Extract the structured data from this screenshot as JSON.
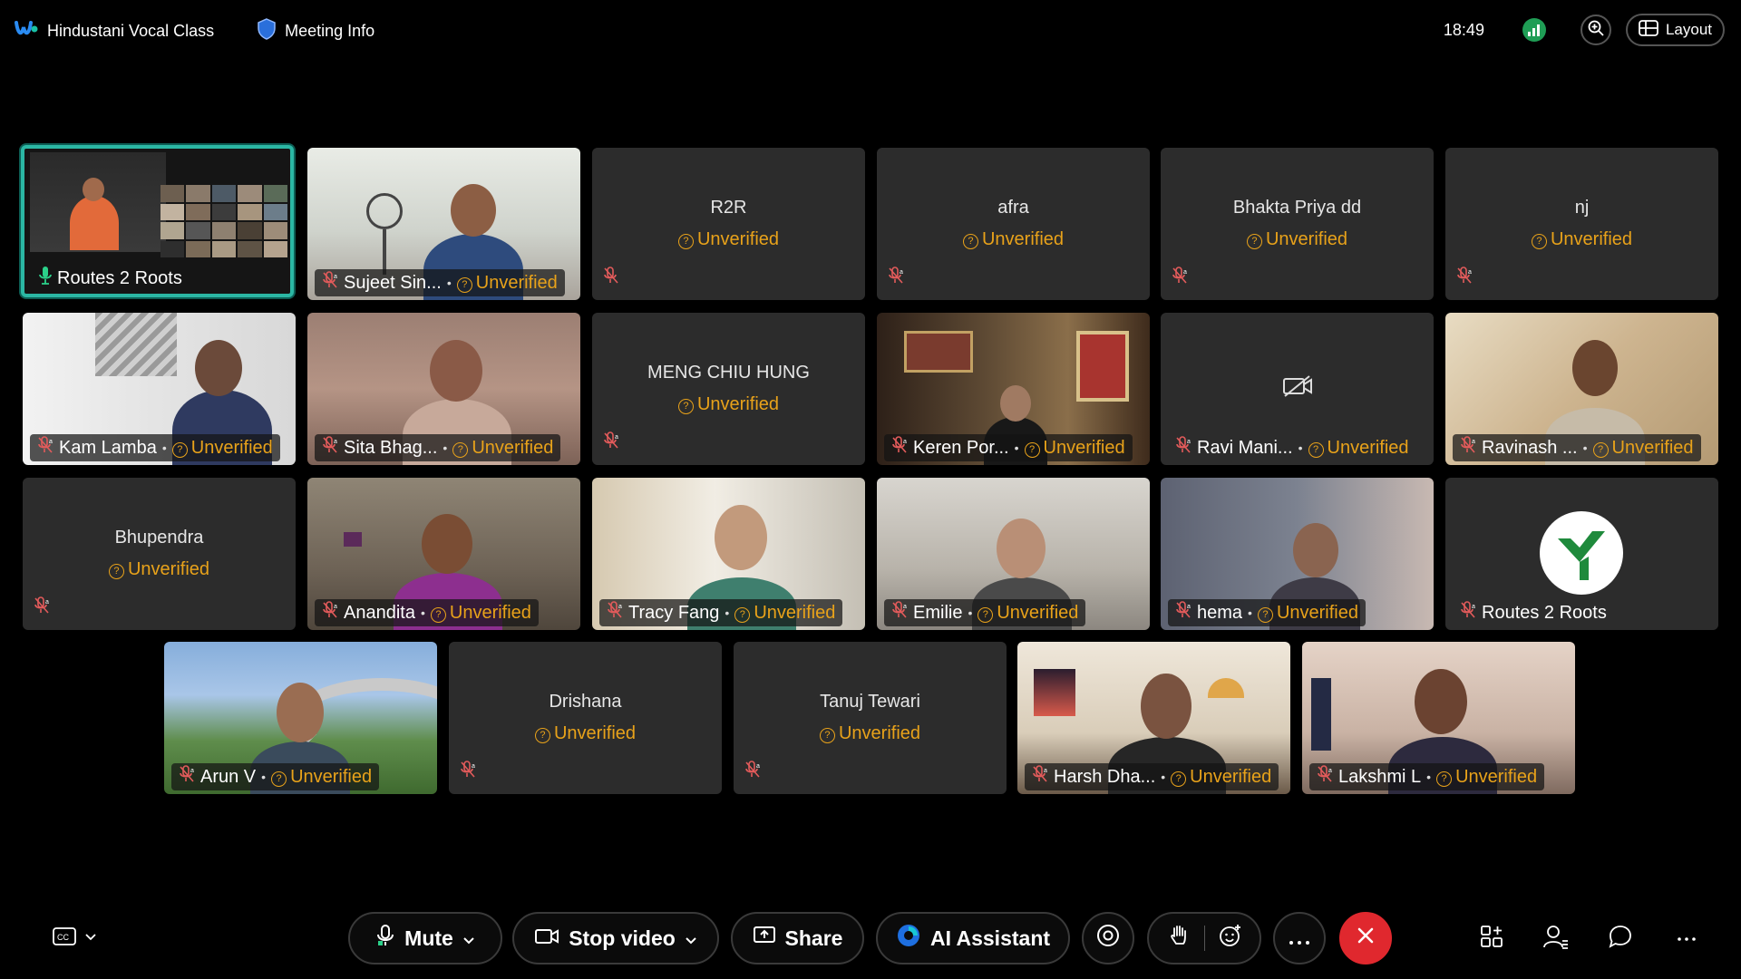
{
  "topbar": {
    "meeting_title": "Hindustani Vocal Class",
    "meeting_info": "Meeting Info",
    "time": "18:49",
    "layout_label": "Layout"
  },
  "tiles": [
    {
      "name": "Routes 2 Roots",
      "status": ""
    },
    {
      "name": "Sujeet Sin...",
      "status": "Unverified"
    },
    {
      "name": "R2R",
      "status": "Unverified"
    },
    {
      "name": "afra",
      "status": "Unverified"
    },
    {
      "name": "Bhakta Priya dd",
      "status": "Unverified"
    },
    {
      "name": "nj",
      "status": "Unverified"
    },
    {
      "name": "Kam Lamba",
      "status": "Unverified"
    },
    {
      "name": "Sita Bhag...",
      "status": "Unverified"
    },
    {
      "name": "MENG CHIU HUNG",
      "status": "Unverified"
    },
    {
      "name": "Keren Por...",
      "status": "Unverified"
    },
    {
      "name": "Ravi Mani...",
      "status": "Unverified"
    },
    {
      "name": "Ravinash ...",
      "status": "Unverified"
    },
    {
      "name": "Bhupendra",
      "status": "Unverified"
    },
    {
      "name": "Anandita",
      "status": "Unverified"
    },
    {
      "name": "Tracy Fang",
      "status": "Unverified"
    },
    {
      "name": "Emilie",
      "status": "Unverified"
    },
    {
      "name": "hema",
      "status": "Unverified"
    },
    {
      "name": "Routes 2 Roots",
      "status": ""
    },
    {
      "name": "Arun V",
      "status": "Unverified"
    },
    {
      "name": "Drishana",
      "status": "Unverified"
    },
    {
      "name": "Tanuj Tewari",
      "status": "Unverified"
    },
    {
      "name": "Harsh Dha...",
      "status": "Unverified"
    },
    {
      "name": "Lakshmi L",
      "status": "Unverified"
    }
  ],
  "controls": {
    "mute": "Mute",
    "stop_video": "Stop video",
    "share": "Share",
    "ai_assistant": "AI Assistant"
  },
  "icons": {
    "brand": "webex-logo",
    "shield": "shield-icon",
    "signal": "network-signal-icon",
    "zoom": "zoom-in-icon",
    "layout": "layout-grid-icon",
    "captions": "closed-captions-icon",
    "mic": "microphone-icon",
    "camera": "video-camera-icon",
    "share": "share-screen-icon",
    "record": "record-icon",
    "hand": "raise-hand-icon",
    "reaction": "reaction-icon",
    "more": "more-icon",
    "end": "end-call-icon",
    "apps": "apps-icon",
    "participants": "participants-icon",
    "chat": "chat-icon",
    "video_off": "video-off-icon"
  },
  "colors": {
    "accent_active": "#2bb7a4",
    "unverified": "#e8a21a",
    "end_call": "#e0282e",
    "tile_bg": "#2c2c2c"
  }
}
